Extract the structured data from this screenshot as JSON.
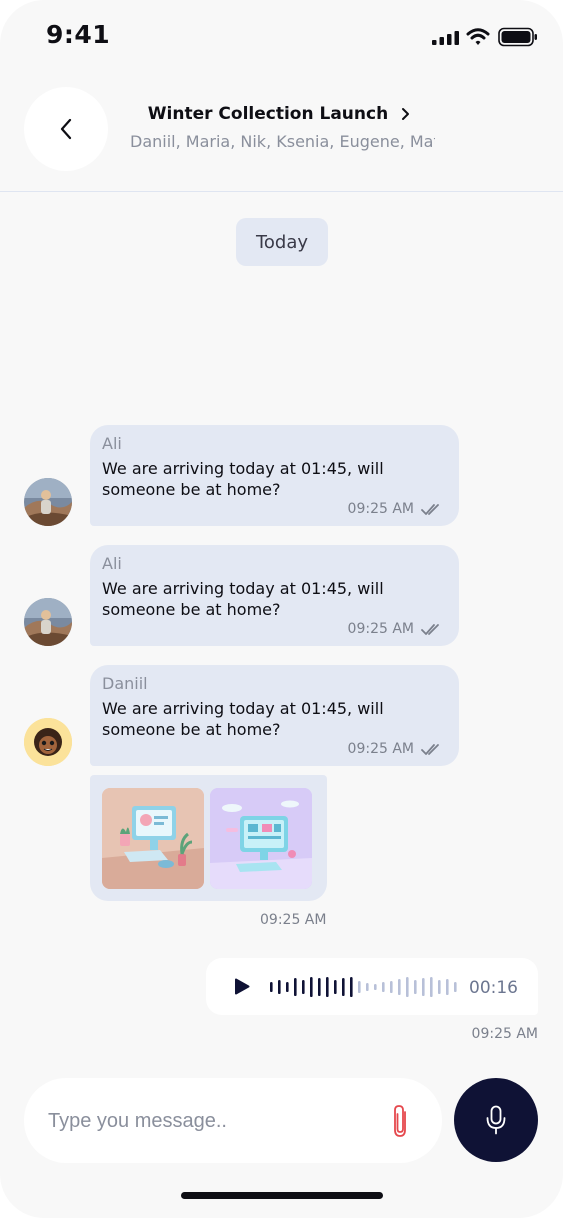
{
  "status_bar": {
    "time": "9:41"
  },
  "header": {
    "title": "Winter Collection Launch",
    "members": "Daniil, Maria, Nik, Ksenia, Eugene, Mat..."
  },
  "date_chip": "Today",
  "messages": [
    {
      "sender": "Ali",
      "text": "We are arriving today at 01:45, will someone be at home?",
      "time": "09:25 AM",
      "avatar": "avatar-ali"
    },
    {
      "sender": "Ali",
      "text": "We are arriving today at 01:45, will someone be at home?",
      "time": "09:25 AM",
      "avatar": "avatar-ali"
    },
    {
      "sender": "Daniil",
      "text": "We are arriving today at 01:45, will someone be at home?",
      "time": "09:25 AM",
      "avatar": "avatar-daniil"
    }
  ],
  "media_message": {
    "time": "09:25 AM",
    "images": [
      "desktop-illustration-1",
      "desktop-illustration-2"
    ]
  },
  "voice_message": {
    "duration": "00:16",
    "time": "09:25 AM",
    "progress": 0.45
  },
  "composer": {
    "placeholder": "Type you message.."
  },
  "colors": {
    "accent": "#0f1235",
    "bubble": "#e3e8f3",
    "attach": "#e5484d"
  }
}
